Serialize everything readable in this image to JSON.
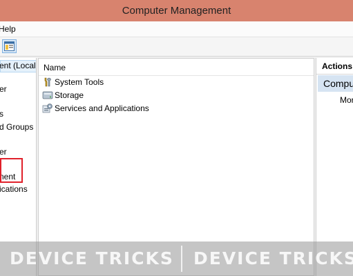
{
  "window": {
    "title": "Computer Management"
  },
  "menu": {
    "items": [
      "Help"
    ]
  },
  "tree": {
    "items": [
      "ent (Local",
      "er",
      "s",
      "d Groups",
      "er",
      "nent",
      "ications"
    ]
  },
  "list": {
    "column": "Name",
    "rows": [
      {
        "label": "System Tools",
        "icon": "tools-icon"
      },
      {
        "label": "Storage",
        "icon": "storage-icon"
      },
      {
        "label": "Services and Applications",
        "icon": "services-icon"
      }
    ]
  },
  "actions": {
    "title": "Actions",
    "section": "Compu",
    "more": "Mor"
  },
  "watermark": {
    "text": "DEVICE TRICKS"
  }
}
